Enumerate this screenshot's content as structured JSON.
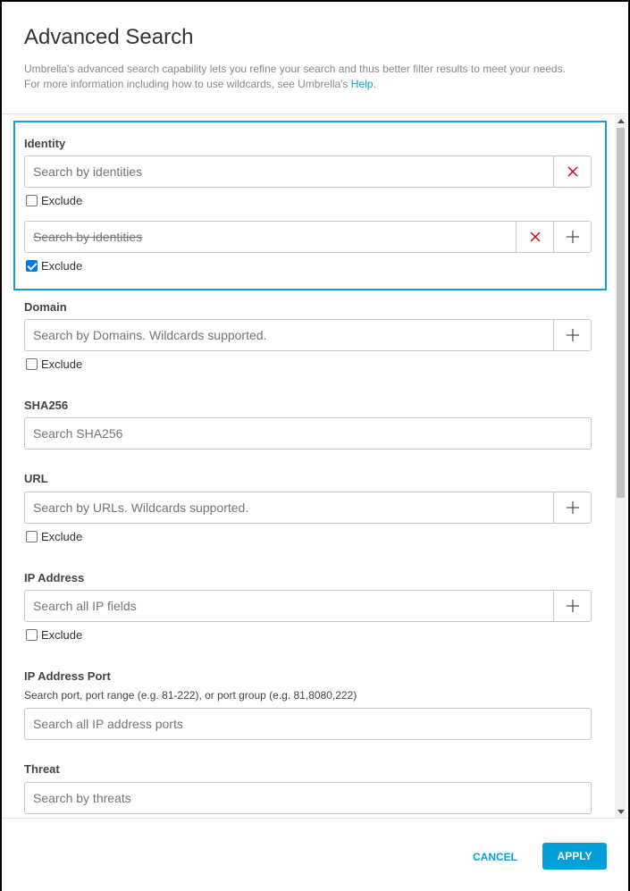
{
  "dialog": {
    "title": "Advanced Search",
    "description_line1": "Umbrella's advanced search capability lets you refine your search and thus better filter results to meet your needs.",
    "description_line2_prefix": "For more information including how to use wildcards, see Umbrella's ",
    "help_link": "Help",
    "description_line2_suffix": "."
  },
  "fields": {
    "identity": {
      "label": "Identity",
      "rows": [
        {
          "placeholder": "Search by identities",
          "exclude_label": "Exclude",
          "excluded": false
        },
        {
          "placeholder": "Search by identities",
          "exclude_label": "Exclude",
          "excluded": true
        }
      ]
    },
    "domain": {
      "label": "Domain",
      "placeholder": "Search by Domains. Wildcards supported.",
      "exclude_label": "Exclude",
      "excluded": false
    },
    "sha256": {
      "label": "SHA256",
      "placeholder": "Search SHA256"
    },
    "url": {
      "label": "URL",
      "placeholder": "Search by URLs. Wildcards supported.",
      "exclude_label": "Exclude",
      "excluded": false
    },
    "ip_address": {
      "label": "IP Address",
      "placeholder": "Search all IP fields",
      "exclude_label": "Exclude",
      "excluded": false
    },
    "ip_port": {
      "label": "IP Address Port",
      "hint": "Search port, port range (e.g. 81-222), or port group (e.g. 81,8080,222)",
      "placeholder": "Search all IP address ports"
    },
    "threat": {
      "label": "Threat",
      "placeholder": "Search by threats"
    }
  },
  "footer": {
    "cancel_label": "CANCEL",
    "apply_label": "APPLY"
  },
  "colors": {
    "accent": "#049fd9",
    "focus_border": "#1a9ad6",
    "clear_icon": "#d0021b"
  }
}
